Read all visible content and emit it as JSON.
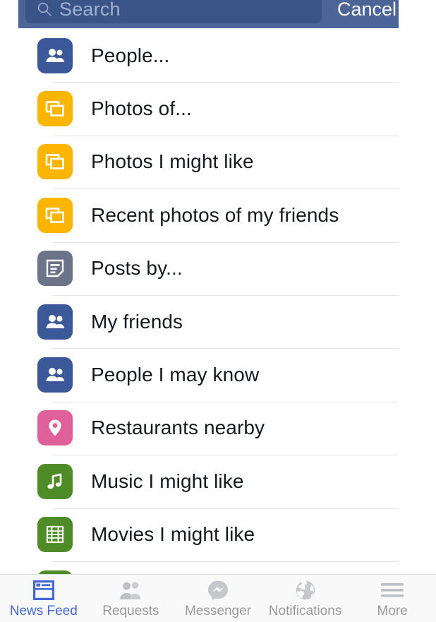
{
  "search": {
    "placeholder": "Search",
    "value": "",
    "search_icon": "search-icon",
    "cancel_label": "Cancel",
    "bar_color": "#4c6498",
    "field_color": "#3a5488"
  },
  "list": {
    "items": [
      {
        "label": "People...",
        "icon": "people-icon",
        "tile_color": "#3b5998"
      },
      {
        "label": "Photos of...",
        "icon": "photos-icon",
        "tile_color": "#f9b500"
      },
      {
        "label": "Photos I might like",
        "icon": "photos-icon",
        "tile_color": "#f9b500"
      },
      {
        "label": "Recent photos of my friends",
        "icon": "photos-icon",
        "tile_color": "#f9b500"
      },
      {
        "label": "Posts by...",
        "icon": "post-icon",
        "tile_color": "#6b7489"
      },
      {
        "label": "My friends",
        "icon": "people-icon",
        "tile_color": "#3b5998"
      },
      {
        "label": "People I may know",
        "icon": "people-icon",
        "tile_color": "#3b5998"
      },
      {
        "label": "Restaurants nearby",
        "icon": "location-pin-icon",
        "tile_color": "#e0619a"
      },
      {
        "label": "Music I might like",
        "icon": "music-note-icon",
        "tile_color": "#4e8c28"
      },
      {
        "label": "Movies I might like",
        "icon": "film-strip-icon",
        "tile_color": "#4e8c28"
      },
      {
        "label": "",
        "icon": "partial-icon",
        "tile_color": "#4e8c28"
      }
    ]
  },
  "tabbar": {
    "active_color": "#4267d8",
    "inactive_color": "#9a9a9a",
    "tabs": [
      {
        "label": "News Feed",
        "icon": "news-feed-icon",
        "active": true
      },
      {
        "label": "Requests",
        "icon": "friend-requests-icon",
        "active": false
      },
      {
        "label": "Messenger",
        "icon": "messenger-icon",
        "active": false
      },
      {
        "label": "Notifications",
        "icon": "globe-icon",
        "active": false
      },
      {
        "label": "More",
        "icon": "hamburger-icon",
        "active": false
      }
    ]
  }
}
